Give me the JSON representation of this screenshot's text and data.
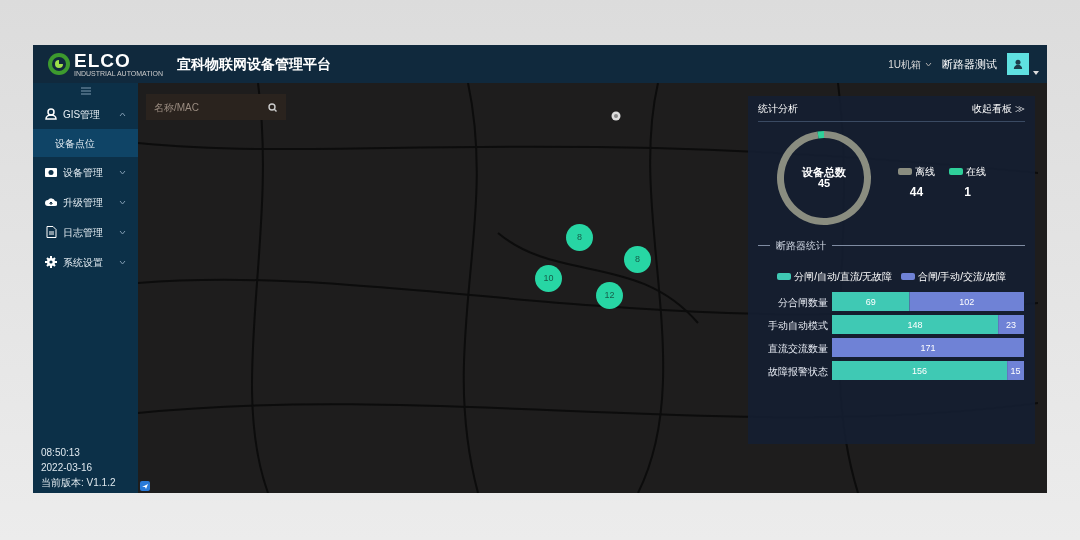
{
  "header": {
    "logo": {
      "wordmark": "ELCO",
      "tagline": "INDUSTRIAL AUTOMATION"
    },
    "title": "宜科物联网设备管理平台",
    "device_select": "1U机箱",
    "user": "断路器测试"
  },
  "sidebar": {
    "items": [
      {
        "label": "GIS管理",
        "expanded": true,
        "children": [
          {
            "label": "设备点位",
            "selected": true
          }
        ]
      },
      {
        "label": "设备管理",
        "expanded": false
      },
      {
        "label": "升级管理",
        "expanded": false
      },
      {
        "label": "日志管理",
        "expanded": false
      },
      {
        "label": "系统设置",
        "expanded": false
      }
    ],
    "footer": {
      "time": "08:50:13",
      "date": "2022-03-16",
      "version": "当前版本: V1.1.2"
    }
  },
  "map": {
    "search": {
      "placeholder": "名称/MAC"
    },
    "clusters": [
      {
        "count": "8"
      },
      {
        "count": "8"
      },
      {
        "count": "10"
      },
      {
        "count": "12"
      }
    ]
  },
  "stats_panel": {
    "title": "统计分析",
    "collapse_link": "收起看板 ≫",
    "donut": {
      "center_label": "设备总数",
      "center_value": "45",
      "chart_data": {
        "type": "donut",
        "categories": [
          "离线",
          "在线"
        ],
        "values": [
          97.8,
          2.2
        ]
      },
      "legend": [
        {
          "value": "44",
          "color": "#8a8d80"
        },
        {
          "value": "1",
          "color": "#2fd09a"
        }
      ]
    },
    "section_title": "断路器统计",
    "bar_chart": {
      "chart_data": {
        "type": "bar",
        "orientation": "horizontal",
        "stacked": true,
        "data_labels": true,
        "legend": "top",
        "categories": [
          "分合闸数量",
          "手动自动模式",
          "直流交流数量",
          "故障报警状态"
        ],
        "series": [
          {
            "name": "分闸/自动/直流/无故障",
            "color": "#3fc9b4",
            "values": [
              69,
              148,
              null,
              156
            ]
          },
          {
            "name": "合闸/手动/交流/故障",
            "color": "#6f82d6",
            "values": [
              102,
              23,
              171,
              15
            ]
          }
        ]
      }
    }
  }
}
